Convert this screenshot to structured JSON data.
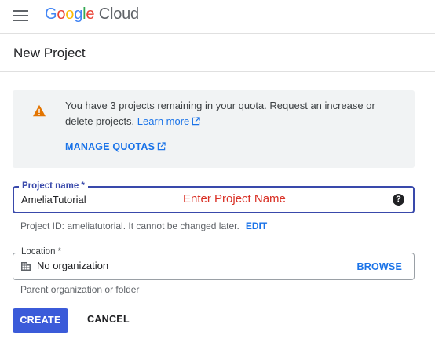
{
  "header": {
    "logo": {
      "letters": [
        {
          "char": "G",
          "color": "#4285F4"
        },
        {
          "char": "o",
          "color": "#EA4335"
        },
        {
          "char": "o",
          "color": "#FBBC05"
        },
        {
          "char": "g",
          "color": "#4285F4"
        },
        {
          "char": "l",
          "color": "#34A853"
        },
        {
          "char": "e",
          "color": "#EA4335"
        }
      ],
      "suffix": " Cloud"
    },
    "menu_icon": "hamburger-menu-icon"
  },
  "page": {
    "title": "New Project"
  },
  "quota": {
    "icon": "warning-icon",
    "message": "You have 3 projects remaining in your quota. Request an increase or delete projects.",
    "learn_more": "Learn more",
    "manage_label": "MANAGE QUOTAS",
    "warning_color": "#E37400",
    "bg_color": "#F1F3F4"
  },
  "project_name": {
    "label": "Project name *",
    "value": "AmeliaTutorial",
    "annotation": "Enter Project Name",
    "help_icon": "help-circle-icon",
    "help_glyph": "?",
    "border_color": "#3949AB"
  },
  "project_id": {
    "text": "Project ID: ameliatutorial. It cannot be changed later.",
    "edit_label": "EDIT"
  },
  "location": {
    "label": "Location *",
    "value": "No organization",
    "icon": "building-icon",
    "browse_label": "BROWSE",
    "helper": "Parent organization or folder"
  },
  "actions": {
    "create_label": "CREATE",
    "cancel_label": "CANCEL",
    "primary_color": "#3B5BD9",
    "link_color": "#1A73E8"
  }
}
